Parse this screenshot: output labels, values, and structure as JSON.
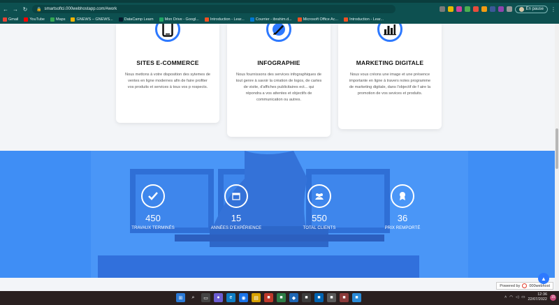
{
  "browser": {
    "url": "smartsoftci.000webhostapp.com/#work",
    "profile_label": "En pause",
    "bookmarks": [
      {
        "label": "Gmail",
        "color": "#ea4335"
      },
      {
        "label": "YouTube",
        "color": "#ff0000"
      },
      {
        "label": "Maps",
        "color": "#34a853"
      },
      {
        "label": "GNEWS – GNEWS...",
        "color": "#f4b400"
      },
      {
        "label": "DataCamp Learn",
        "color": "#05192d"
      },
      {
        "label": "Mon Drive - Googl...",
        "color": "#1fa463"
      },
      {
        "label": "Introduction - Lear...",
        "color": "#f25022"
      },
      {
        "label": "Courrier - ibrahim.d...",
        "color": "#0078d4"
      },
      {
        "label": "Microsoft Office Ac...",
        "color": "#f25022"
      },
      {
        "label": "Introduction - Lear...",
        "color": "#f25022"
      }
    ]
  },
  "services": [
    {
      "title": "SITES E-COMMERCE",
      "icon": "smartphone-icon",
      "text": "Nous mettons à votre disposition des sytemes de ventes en ligne modernes afin de faire profiter vos produits et services à tous vos p rospects."
    },
    {
      "title": "INFOGRAPHIE",
      "icon": "paintbrush-icon",
      "text": "Nous fournissons des services infographiques de tout genre à savoir la création de logos, de cartes de visite, d'affiches publicitaires ect... qui répondra a vos attentes et objectifs de communication ou autres."
    },
    {
      "title": "MARKETING DIGITALE",
      "icon": "bar-chart-icon",
      "text": "Nous vous créons une image et une présence importante en ligne à travers notes programme de marketing digitale, dans l'objectif de f aire la promotion de vos sevices et produits."
    }
  ],
  "stats": [
    {
      "value": "450",
      "label": "TRAVAUX TERMINÉS",
      "icon": "check-icon"
    },
    {
      "value": "15",
      "label": "ANNÉES D'EXPÉRIENCE",
      "icon": "calendar-icon"
    },
    {
      "value": "550",
      "label": "TOTAL CLIENTS",
      "icon": "users-icon"
    },
    {
      "value": "36",
      "label": "PRIX REMPORTÉ",
      "icon": "award-icon"
    }
  ],
  "footer": {
    "powered_by": "Powered by",
    "host_brand": "000webhost"
  },
  "taskbar": {
    "time": "12:36",
    "date": "22/07/2022",
    "notifications": "15"
  },
  "colors": {
    "accent": "#2d79ff",
    "stats_bg": "#3f8ef5",
    "chrome": "#0d5050"
  }
}
